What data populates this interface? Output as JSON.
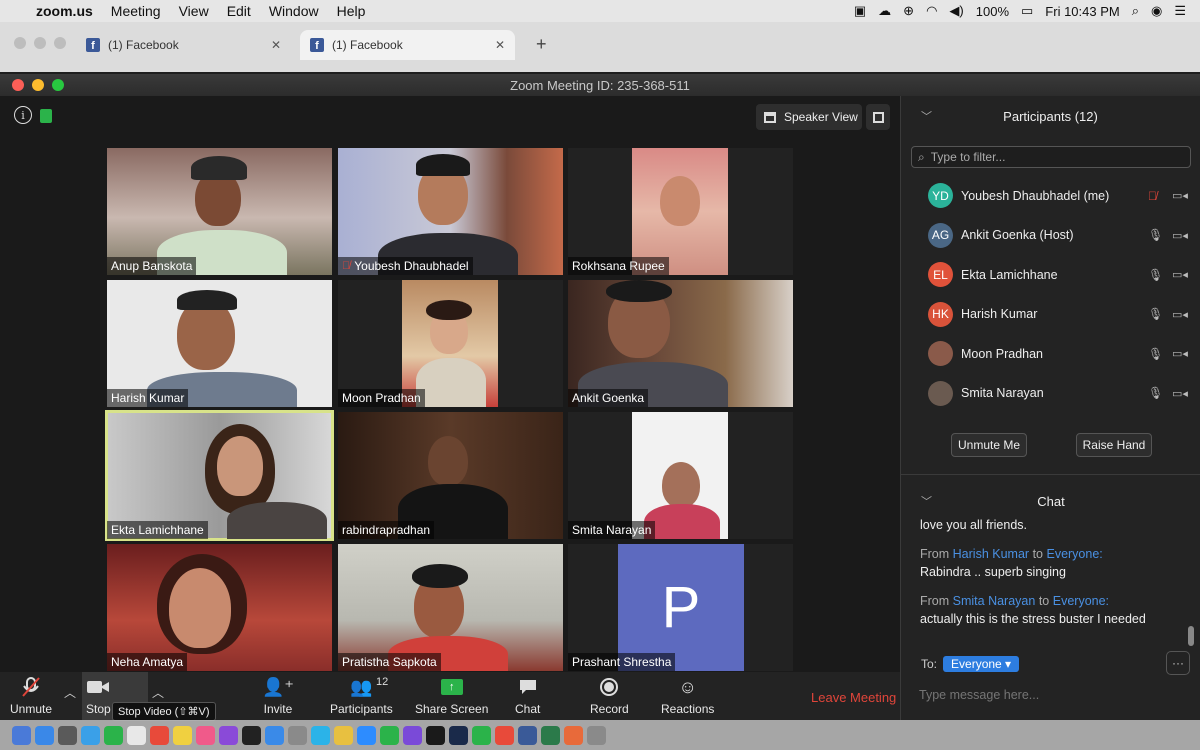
{
  "menubar": {
    "app": "zoom.us",
    "menus": [
      "Meeting",
      "View",
      "Edit",
      "Window",
      "Help"
    ],
    "battery": "100%",
    "clock": "Fri 10:43 PM"
  },
  "browser": {
    "tabs": [
      {
        "label": "(1) Facebook"
      },
      {
        "label": "(1) Facebook"
      }
    ]
  },
  "window": {
    "title": "Zoom Meeting ID: 235-368-511"
  },
  "stage": {
    "speaker_view": "Speaker View",
    "tiles": [
      {
        "name": "Anup Banskota",
        "muted": false,
        "active": false
      },
      {
        "name": "Youbesh Dhaubhadel",
        "muted": true,
        "active": false
      },
      {
        "name": "Rokhsana Rupee",
        "muted": false,
        "active": false
      },
      {
        "name": "Harish Kumar",
        "muted": false,
        "active": false
      },
      {
        "name": "Moon Pradhan",
        "muted": false,
        "active": false
      },
      {
        "name": "Ankit Goenka",
        "muted": false,
        "active": false
      },
      {
        "name": "Ekta Lamichhane",
        "muted": false,
        "active": true
      },
      {
        "name": "rabindrapradhan",
        "muted": false,
        "active": false
      },
      {
        "name": "Smita Narayan",
        "muted": false,
        "active": false
      },
      {
        "name": "Neha Amatya",
        "muted": false,
        "active": false
      },
      {
        "name": "Pratistha Sapkota",
        "muted": false,
        "active": false
      },
      {
        "name": "Prashant Shrestha",
        "muted": false,
        "active": false,
        "avatar_letter": "P"
      }
    ]
  },
  "toolbar": {
    "unmute": "Unmute",
    "stop": "Stop",
    "stop_video_tooltip": "Stop Video (⇧⌘V)",
    "invite": "Invite",
    "participants": "Participants",
    "participants_count": "12",
    "share_screen": "Share Screen",
    "chat": "Chat",
    "record": "Record",
    "reactions": "Reactions",
    "leave": "Leave Meeting"
  },
  "participants_panel": {
    "title": "Participants (12)",
    "filter_placeholder": "Type to filter...",
    "list": [
      {
        "initials": "YD",
        "name": "Youbesh Dhaubhadel (me)",
        "color": "#2bb39a",
        "muted": true
      },
      {
        "initials": "AG",
        "name": "Ankit Goenka (Host)",
        "color": "#4a6785",
        "muted": false
      },
      {
        "initials": "EL",
        "name": "Ekta Lamichhane",
        "color": "#e0523a",
        "muted": false
      },
      {
        "initials": "HK",
        "name": "Harish Kumar",
        "color": "#d9533a",
        "muted": false
      },
      {
        "initials": "",
        "name": "Moon Pradhan",
        "color": "#8a5a4a",
        "muted": false
      },
      {
        "initials": "",
        "name": "Smita Narayan",
        "color": "#6a5a50",
        "muted": false
      }
    ],
    "unmute_me": "Unmute Me",
    "raise_hand": "Raise Hand"
  },
  "chat": {
    "title": "Chat",
    "first_line": "love you all friends.",
    "messages": [
      {
        "from_label": "From",
        "from": "Harish Kumar",
        "to_label": "to",
        "to": "Everyone:",
        "text": "Rabindra .. superb singing"
      },
      {
        "from_label": "From",
        "from": "Smita Narayan",
        "to_label": "to",
        "to": "Everyone:",
        "text": "actually this is the stress buster I needed"
      }
    ],
    "to_label": "To:",
    "to_value": "Everyone",
    "input_placeholder": "Type message here..."
  }
}
